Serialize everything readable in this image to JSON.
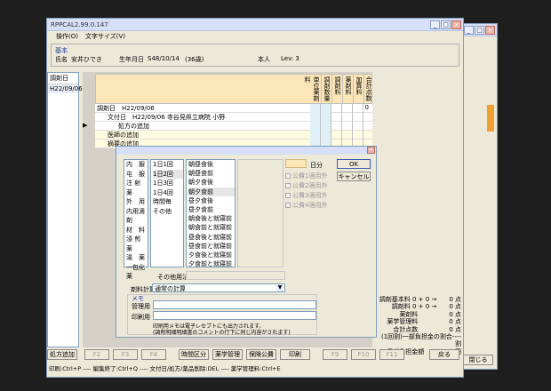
{
  "window": {
    "title": "RPPCAL2.99.0.147",
    "menus": [
      "操作(O)",
      "文字サイズ(V)"
    ]
  },
  "patient": {
    "section_label": "基本",
    "name_label": "氏名",
    "name_value": "安井ひでき",
    "birth_label": "生年月日",
    "birth_value": "S48/10/14",
    "age_value": "(36歳)",
    "honnin": "本人",
    "lev": "Lev: 3"
  },
  "left_list": {
    "header": "調剤日",
    "items": [
      "H22/09/06"
    ]
  },
  "grid": {
    "col_headers": [
      "単位薬剤料",
      "調剤数量",
      "調剤料",
      "薬剤料",
      "加算料",
      "合計点数"
    ],
    "rows": [
      {
        "text": "調剤日　H22/09/06",
        "value": "0"
      },
      {
        "text": "文付日　H22/09/06 寺谷見県立病院 小野",
        "value": ""
      },
      {
        "text": "処方の追加",
        "value": ""
      },
      {
        "text": "医師の追加",
        "value": ""
      },
      {
        "text": "摘要の追加",
        "value": ""
      }
    ]
  },
  "dialog": {
    "list1": [
      "内　服",
      "屯　服",
      "注 射 薬",
      "外　用",
      "内用滴剤",
      "材　料",
      "浸 煎 薬",
      "湯　薬",
      "一包化薬"
    ],
    "list2": [
      "1日1回",
      "1日2回",
      "1日3回",
      "1日4回",
      "時間毎",
      "その他"
    ],
    "list3": [
      "朝昼食後",
      "朝昼食前",
      "朝夕食後",
      "朝夕食前",
      "昼夕食後",
      "昼夕食前",
      "朝食後と就寝前",
      "朝食前と就寝前",
      "昼食後と就寝前",
      "昼食前と就寝前",
      "夕食後と就寝前",
      "夕食前と就寝前"
    ],
    "days_unit": "日分",
    "checks": [
      "公費1適用外",
      "公費2適用外",
      "公費3適用外",
      "公費4適用外"
    ],
    "ok_label": "OK",
    "cancel_label": "キャンセル",
    "other_usage_label": "その他用法",
    "calc_label": "剤料計算",
    "calc_value": "通常の計算",
    "memo_label": "メモ",
    "kanri_label": "管理用",
    "insatsu_label": "印刷用",
    "note1": "印刷用メモは電子レセプトにも出力されます。",
    "note2": "(調剤明細明細書のコメントの行下に同じ内容がされます)"
  },
  "summary": [
    "調剤基本料 0 + 0 →　　0 点",
    "調剤料 0 + 0 →　　0 点",
    "薬剤料　　　　　0 点",
    "薬学管理料　　　　　0 点",
    "合計点数　　　　　0 点",
    "(1回割)一部負担金の割合---- 割",
    "患者負担金額　　　　0 円"
  ],
  "toolbar": {
    "buttons": [
      "処方追加",
      "F2",
      "F3",
      "F4",
      "時間区分",
      "薬学管理",
      "保険公費",
      "印刷",
      "F9",
      "F10",
      "F11",
      "戻る"
    ]
  },
  "status_bar": "印刷:Ctrl+P ---- 編集終了:Ctrl+Q ---- 文付日/処方/薬品削除:DEL ---- 薬学管理料:Ctrl+E",
  "back_window": {
    "close_label": "閉じる"
  }
}
